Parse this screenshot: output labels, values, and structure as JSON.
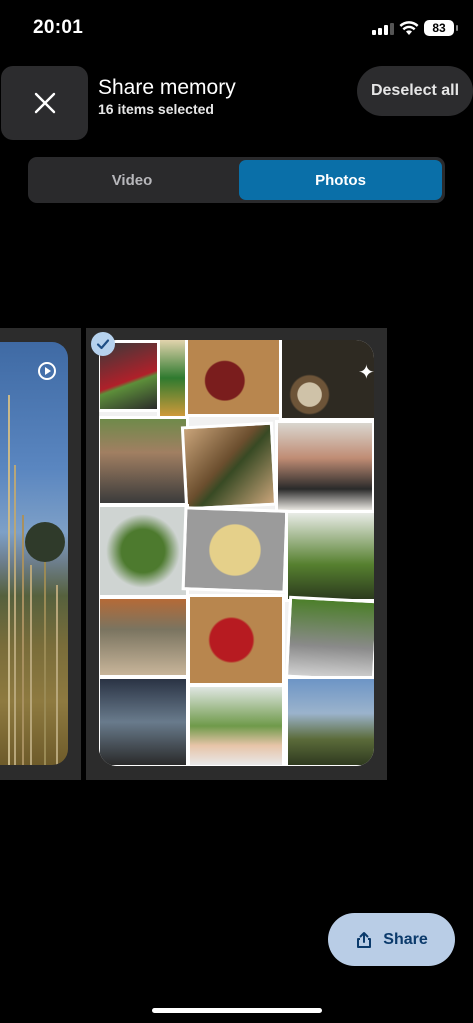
{
  "status_bar": {
    "time": "20:01",
    "battery": "83"
  },
  "header": {
    "title": "Share memory",
    "subtitle": "16 items selected",
    "deselect_label": "Deselect all"
  },
  "tabs": [
    {
      "label": "Video",
      "selected": false
    },
    {
      "label": "Photos",
      "selected": true
    }
  ],
  "carousel": {
    "left_card": {
      "type": "video",
      "icon": "play-circle-icon"
    },
    "main_card": {
      "type": "photo-collage",
      "selected": true,
      "icon": "sparkle-icon"
    }
  },
  "share_button": {
    "label": "Share",
    "icon": "share-icon"
  },
  "colors": {
    "accent": "#0a6fa8",
    "share_bg": "#b9cde6",
    "share_text": "#0b3a6b"
  }
}
